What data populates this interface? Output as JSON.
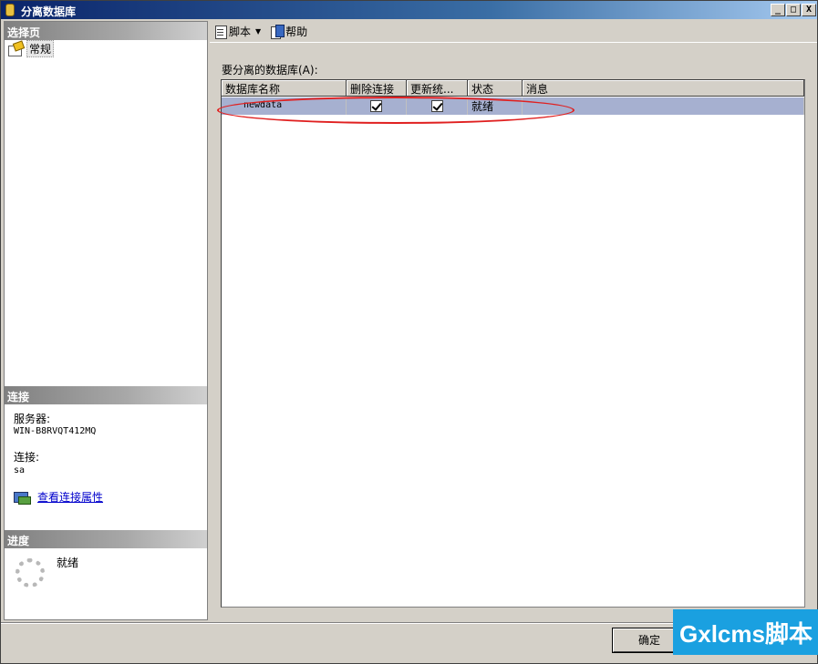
{
  "window": {
    "title": "分离数据库",
    "controls": [
      "_",
      "□",
      "X"
    ]
  },
  "left": {
    "select_page_header": "选择页",
    "pages": [
      {
        "label": "常规",
        "icon": "general-page-icon"
      }
    ],
    "connection_header": "连接",
    "server_label": "服务器:",
    "server_value": "WIN-B8RVQT412MQ",
    "connection_label": "连接:",
    "connection_value": "sa",
    "view_connection_link": "查看连接属性",
    "progress_header": "进度",
    "progress_status": "就绪"
  },
  "toolbar": {
    "script_label": "脚本",
    "help_label": "帮助"
  },
  "grid": {
    "label": "要分离的数据库(A):",
    "columns": [
      "数据库名称",
      "删除连接",
      "更新统...",
      "状态",
      "消息"
    ],
    "rows": [
      {
        "name": "newdata",
        "drop_connections": true,
        "update_statistics": true,
        "status": "就绪",
        "message": ""
      }
    ]
  },
  "footer": {
    "ok_label": "确定"
  },
  "watermark": "Gxlcms脚本",
  "colors": {
    "title_bar_start": "#0a246a",
    "row_highlight": "#a6b0d0",
    "annotation_ellipse": "#e02020",
    "watermark_bg": "#1aa0e0"
  }
}
